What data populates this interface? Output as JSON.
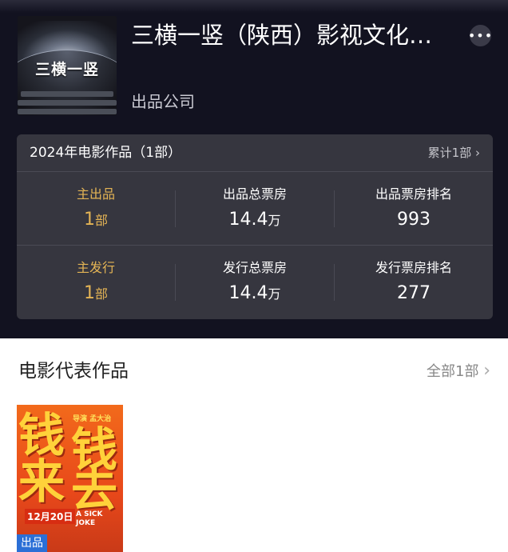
{
  "company": {
    "name": "三横一竖（陕西）影视文化…",
    "type": "出品公司",
    "logo_text": "三横一竖"
  },
  "stats": {
    "title": "2024年电影作品（1部）",
    "total_link": "累计1部",
    "rows": [
      {
        "role_label": "主出品",
        "role_value": "1",
        "role_unit": "部",
        "box_label": "出品总票房",
        "box_value": "14.4",
        "box_unit": "万",
        "rank_label": "出品票房排名",
        "rank_value": "993"
      },
      {
        "role_label": "主发行",
        "role_value": "1",
        "role_unit": "部",
        "box_label": "发行总票房",
        "box_value": "14.4",
        "box_unit": "万",
        "rank_label": "发行票房排名",
        "rank_value": "277"
      }
    ]
  },
  "representative": {
    "title": "电影代表作品",
    "all_link": "全部1部",
    "movies": [
      {
        "badge": "出品",
        "poster_title": [
          "钱",
          "来",
          "钱",
          "去"
        ],
        "poster_credit": "导演 孟大治",
        "poster_date": "12月20日",
        "poster_english": [
          "A SICK",
          "JOKE"
        ]
      }
    ]
  },
  "colors": {
    "gold": "#e4b455",
    "badge_blue": "#2b6fd6",
    "hero_bg": "#121220",
    "card_bg": "#36363f"
  },
  "icons": {
    "more": "more-dots-icon",
    "chevron": "chevron-right-icon"
  }
}
